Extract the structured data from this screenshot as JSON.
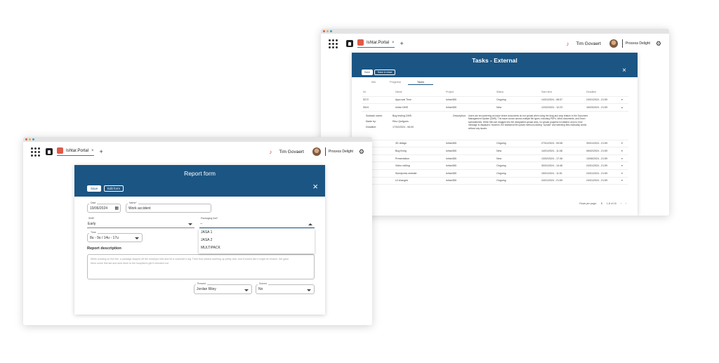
{
  "back": {
    "tab_title": "Ishtar.Portal",
    "user_name": "Tim Govaert",
    "logo_text": "Process Delight",
    "panel_title": "Tasks - External",
    "buttons": {
      "save": "Save",
      "save_close": "Save & close"
    },
    "tabs": [
      "Info",
      "Progress",
      "Tasks"
    ],
    "active_tab": "Tasks",
    "table_headers": [
      "Nr.",
      "Name",
      "Project",
      "Status",
      "Start time",
      "Deadline"
    ],
    "rows_top": [
      [
        "5272",
        "Approval Time",
        "Ishtar365",
        "Ongoing",
        "14/01/2024 - 08:57",
        "24/01/2024 - 21:59"
      ],
      [
        "5524",
        "Ishtar DMS",
        "Ishtar365",
        "New",
        "12/02/2024 - 12:23",
        "16/03/2024 - 21:59"
      ]
    ],
    "expanded": {
      "subtask_label": "Subtask name:",
      "subtask_value": "Bug testing DMS",
      "made_by_label": "Made by:",
      "made_by_value": "Rino Quitgoes",
      "deadline_label": "Deadline:",
      "deadline_value": "17/02/2024 - 06:00",
      "description_label": "Description:",
      "description_value": "Users are encountering an issue where documents do not upload when using the drag and drop feature in the Document Management System (DMS). The issue occurs across multiple file types, including PDFs, Word documents, and Excel spreadsheets. When files are dragged into the designated upload area, no upload progress is initiated, and no error message is displayed. However, the traditional file upload method (clicking \"Upload\" and selecting files manually) works without any issues."
    },
    "rows_bottom": [
      [
        "",
        "3D design",
        "Ishtar365",
        "Ongoing",
        "27/01/2024 - 09:08",
        "30/01/2024 - 21:59"
      ],
      [
        "",
        "Bug fixing",
        "Ishtar365",
        "New",
        "14/01/2024 - 11:08",
        "06/02/2024 - 21:59"
      ],
      [
        "",
        "Presentation",
        "Ishtar365",
        "New",
        "13/02/2024 - 17:36",
        "13/06/2024 - 21:59"
      ],
      [
        "",
        "Video editing",
        "Ishtar365",
        "Ongoing",
        "30/01/2024 - 14:46",
        "24/01/2024 - 21:59"
      ],
      [
        "",
        "Wordpress website",
        "Ishtar365",
        "Ongoing",
        "15/01/2024 - 11:51",
        "24/01/2024 - 21:59"
      ],
      [
        "",
        "UI changes",
        "Ishtar365",
        "Ongoing",
        "24/01/2024 - 21:59",
        "24/01/2024 - 21:59"
      ]
    ],
    "pagination": {
      "rows_per_page": "Rows per page:",
      "rows_value": "8",
      "range": "1-8 of 15"
    }
  },
  "front": {
    "tab_title": "Ishtar.Portal",
    "user_name": "Tim Govaert",
    "logo_text": "Process Delight",
    "panel_title": "Report form",
    "buttons": {
      "save": "Save",
      "edit_form": "Edit form"
    },
    "date": {
      "label": "Date",
      "value": "19/06/2024"
    },
    "name": {
      "label": "Name*",
      "value": "Work accident"
    },
    "shift": {
      "label": "Shift*",
      "value": "Early"
    },
    "packaging": {
      "label": "Packaging line*",
      "value": "--",
      "options": [
        "JASA 1",
        "JASA 2",
        "MULTIPACK"
      ]
    },
    "time": {
      "label": "Time",
      "value": "8u - 9u / 14u - 17u"
    },
    "description": {
      "heading": "Report description",
      "text": "While working on the line, a package slipped off the conveyor belt and hit a coworker's leg. Their foot started swelling up pretty bad, and it looked like it might be broken. We gave them some first aid and sent them to the hospital to get it checked out."
    },
    "present": {
      "label": "Present",
      "value": "Jordan Riley"
    },
    "solved": {
      "label": "Solved",
      "value": "No"
    }
  },
  "colors": {
    "header_blue": "#1b5583",
    "accent_red": "#e05a4a",
    "link_blue": "#2a7ab0"
  }
}
